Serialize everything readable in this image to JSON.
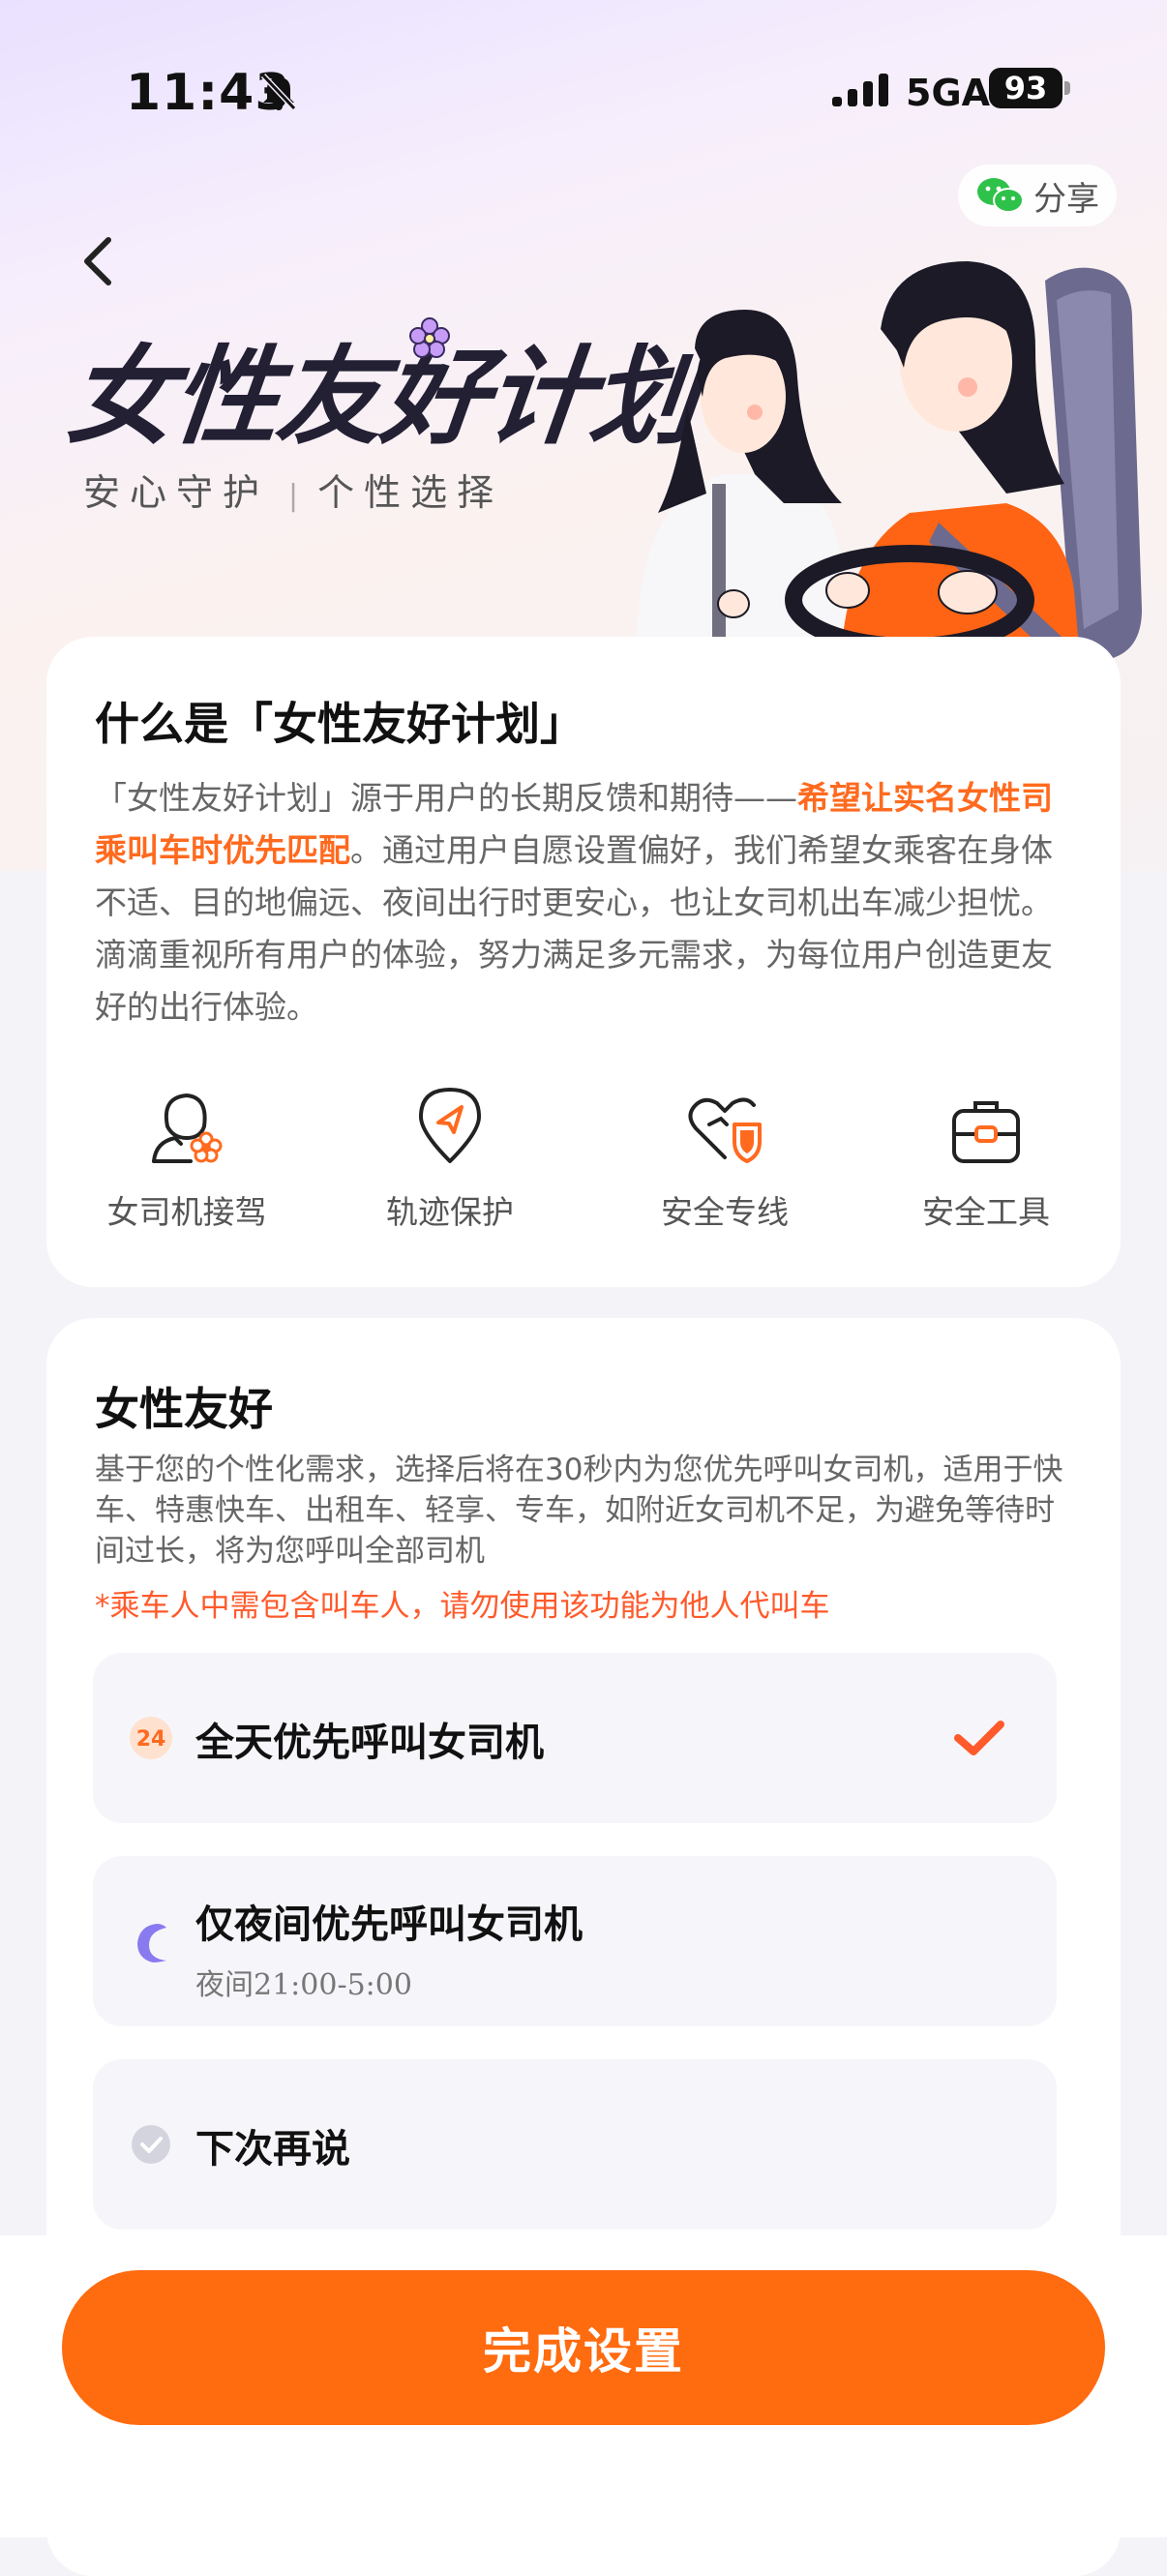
{
  "status_bar": {
    "time": "11:43",
    "network": "5GA",
    "battery": "93"
  },
  "header": {
    "share_label": "分享",
    "title": "女性友好计划",
    "subtitle_left": "安心守护",
    "subtitle_sep": "|",
    "subtitle_right": "个性选择"
  },
  "about": {
    "title": "什么是「女性友好计划」",
    "desc_part1": "「女性友好计划」源于用户的长期反馈和期待——",
    "desc_highlight": "希望让实名女性司乘叫车时优先匹配",
    "desc_part2": "。通过用户自愿设置偏好，我们希望女乘客在身体不适、目的地偏远、夜间出行时更安心，也让女司机出车减少担忧。滴滴重视所有用户的体验，努力满足多元需求，为每位用户创造更友好的出行体验。",
    "features": [
      {
        "label": "女司机接驾",
        "icon": "female-driver-icon"
      },
      {
        "label": "轨迹保护",
        "icon": "route-protect-icon"
      },
      {
        "label": "安全专线",
        "icon": "safety-hotline-icon"
      },
      {
        "label": "安全工具",
        "icon": "safety-toolkit-icon"
      }
    ]
  },
  "preference": {
    "title": "女性友好",
    "desc": "基于您的个性化需求，选择后将在30秒内为您优先呼叫女司机，适用于快车、特惠快车、出租车、轻享、专车，如附近女司机不足，为避免等待时间过长，将为您呼叫全部司机",
    "warning": "*乘车人中需包含叫车人，请勿使用该功能为他人代叫车",
    "options": [
      {
        "label": "全天优先呼叫女司机",
        "icon": "24h-icon",
        "icon_text": "24",
        "selected": true
      },
      {
        "label": "仅夜间优先呼叫女司机",
        "sublabel": "夜间21:00-5:00",
        "icon": "moon-icon",
        "selected": false
      },
      {
        "label": "下次再说",
        "icon": "check-circle-icon",
        "selected": false
      }
    ]
  },
  "footer": {
    "done_label": "完成设置"
  },
  "colors": {
    "accent": "#ff6b0f",
    "highlight": "#ff6a1f",
    "warning": "#ff5a2b",
    "moon": "#8a7af0"
  }
}
